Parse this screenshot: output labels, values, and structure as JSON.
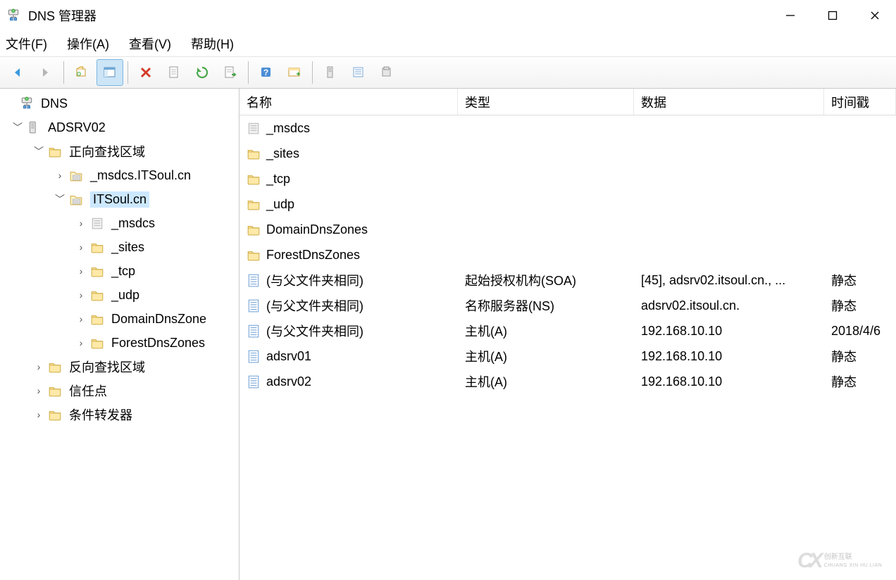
{
  "window": {
    "title": "DNS 管理器"
  },
  "menu": {
    "file": "文件(F)",
    "action": "操作(A)",
    "view": "查看(V)",
    "help": "帮助(H)"
  },
  "tree": {
    "root": "DNS",
    "server": "ADSRV02",
    "fwd_zone_label": "正向查找区域",
    "zone_msdcs": "_msdcs.ITSoul.cn",
    "zone_main": "ITSoul.cn",
    "sub_msdcs": "_msdcs",
    "sub_sites": "_sites",
    "sub_tcp": "_tcp",
    "sub_udp": "_udp",
    "sub_domain_dns": "DomainDnsZone",
    "sub_forest_dns": "ForestDnsZones",
    "rev_zone_label": "反向查找区域",
    "trust_points": "信任点",
    "cond_fwd": "条件转发器"
  },
  "columns": {
    "name": "名称",
    "type": "类型",
    "data": "数据",
    "timestamp": "时间戳"
  },
  "rows": [
    {
      "icon": "zone-tag",
      "name": "_msdcs",
      "type": "",
      "data": "",
      "ts": ""
    },
    {
      "icon": "folder",
      "name": "_sites",
      "type": "",
      "data": "",
      "ts": ""
    },
    {
      "icon": "folder",
      "name": "_tcp",
      "type": "",
      "data": "",
      "ts": ""
    },
    {
      "icon": "folder",
      "name": "_udp",
      "type": "",
      "data": "",
      "ts": ""
    },
    {
      "icon": "folder",
      "name": "DomainDnsZones",
      "type": "",
      "data": "",
      "ts": ""
    },
    {
      "icon": "folder",
      "name": "ForestDnsZones",
      "type": "",
      "data": "",
      "ts": ""
    },
    {
      "icon": "record",
      "name": "(与父文件夹相同)",
      "type": "起始授权机构(SOA)",
      "data": "[45], adsrv02.itsoul.cn., ...",
      "ts": "静态"
    },
    {
      "icon": "record",
      "name": "(与父文件夹相同)",
      "type": "名称服务器(NS)",
      "data": "adsrv02.itsoul.cn.",
      "ts": "静态"
    },
    {
      "icon": "record",
      "name": "(与父文件夹相同)",
      "type": "主机(A)",
      "data": "192.168.10.10",
      "ts": "2018/4/6"
    },
    {
      "icon": "record",
      "name": "adsrv01",
      "type": "主机(A)",
      "data": "192.168.10.10",
      "ts": "静态"
    },
    {
      "icon": "record",
      "name": "adsrv02",
      "type": "主机(A)",
      "data": "192.168.10.10",
      "ts": "静态"
    }
  ],
  "watermark": {
    "logo": "CX",
    "line1": "创新互联",
    "line2": "CHUANG XIN HU LIAN"
  }
}
